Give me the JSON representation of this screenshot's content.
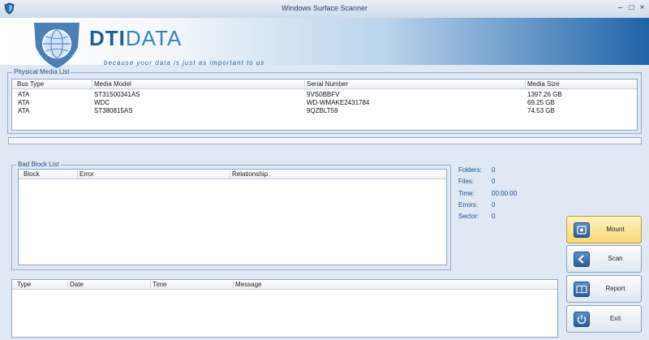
{
  "window": {
    "title": "Windows Surface Scanner"
  },
  "banner": {
    "logo_part1": "DTI",
    "logo_part2": "DATA",
    "tagline": "because your data is just as important to us"
  },
  "physical_media": {
    "title": "Physical Media List",
    "columns": [
      "Bus Type",
      "Media Model",
      "Serial Number",
      "Media Size"
    ],
    "rows": [
      [
        "ATA",
        "ST31500341AS",
        "9VS0BBFV",
        "1397.26 GB"
      ],
      [
        "ATA",
        "WDC",
        "WD-WMAKE2431784",
        "69.25 GB"
      ],
      [
        "ATA",
        "ST380815AS",
        "9QZBLT59",
        "74.53 GB"
      ]
    ]
  },
  "bad_blocks": {
    "title": "Bad Block List",
    "columns": [
      "Block",
      "Error",
      "Relationship"
    ]
  },
  "stats": {
    "folders_label": "Folders:",
    "folders": "0",
    "files_label": "Files:",
    "files": "0",
    "time_label": "Time:",
    "time": "00:00:00",
    "errors_label": "Errors:",
    "errors": "0",
    "sector_label": "Sector:",
    "sector": "0"
  },
  "log": {
    "columns": [
      "Type",
      "Date",
      "Time",
      "Message"
    ]
  },
  "buttons": {
    "mount": "Mount",
    "scan": "Scan",
    "report": "Report",
    "exit": "Exit"
  },
  "colors": {
    "accent": "#1f5c9e",
    "active_button": "#f8d774"
  },
  "icons": [
    "shield-icon",
    "globe-icon",
    "drive-icon",
    "scan-icon",
    "book-icon",
    "power-icon"
  ]
}
